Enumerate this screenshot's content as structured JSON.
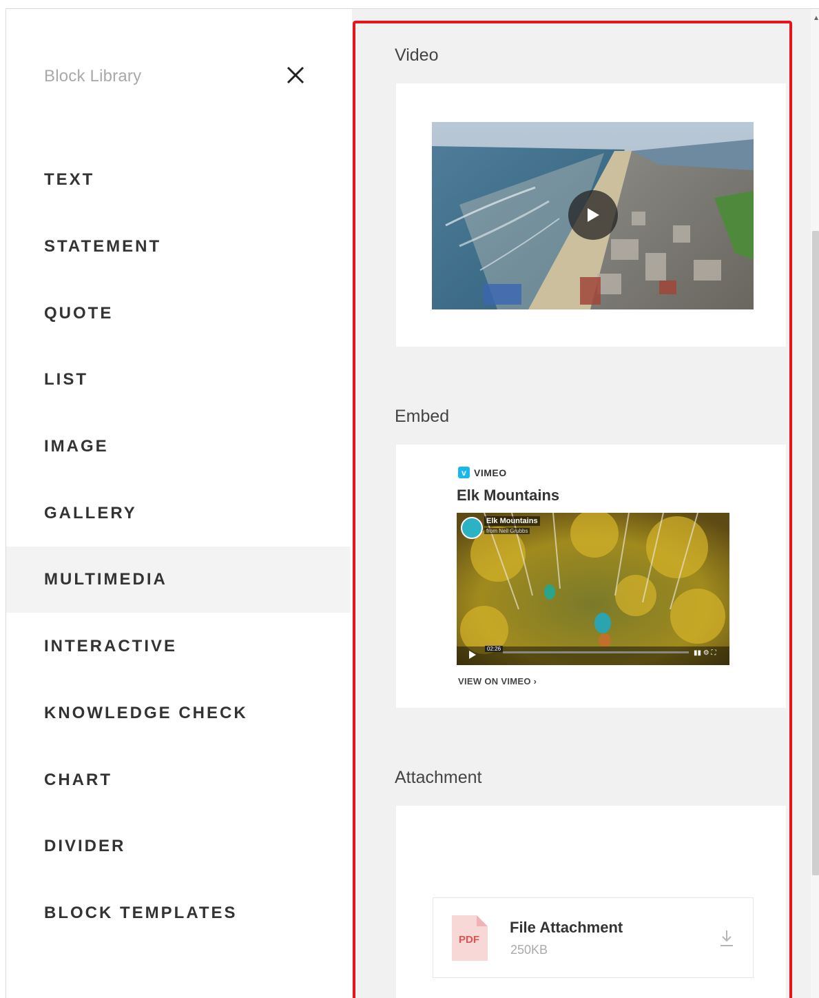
{
  "sidebar": {
    "title": "Block Library",
    "items": [
      {
        "label": "TEXT"
      },
      {
        "label": "STATEMENT"
      },
      {
        "label": "QUOTE"
      },
      {
        "label": "LIST"
      },
      {
        "label": "IMAGE"
      },
      {
        "label": "GALLERY"
      },
      {
        "label": "MULTIMEDIA",
        "active": true
      },
      {
        "label": "INTERACTIVE"
      },
      {
        "label": "KNOWLEDGE CHECK"
      },
      {
        "label": "CHART"
      },
      {
        "label": "DIVIDER"
      },
      {
        "label": "BLOCK TEMPLATES"
      }
    ]
  },
  "panel": {
    "video": {
      "label": "Video"
    },
    "embed": {
      "label": "Embed",
      "provider": "VIMEO",
      "title": "Elk Mountains",
      "overlay_title": "Elk Mountains",
      "overlay_sub": "from Neil Grubbs",
      "time": "02:26",
      "link": "VIEW ON VIMEO"
    },
    "attachment": {
      "label": "Attachment",
      "file_type": "PDF",
      "file_name": "File Attachment",
      "file_size": "250KB"
    }
  },
  "colors": {
    "highlight_outline": "#e8141b",
    "vimeo_brand": "#1ab7ea",
    "pdf": "#e05252"
  },
  "icons": {
    "close": "close-icon",
    "play": "play-icon",
    "download": "download-icon",
    "pdf": "pdf-file-icon"
  }
}
